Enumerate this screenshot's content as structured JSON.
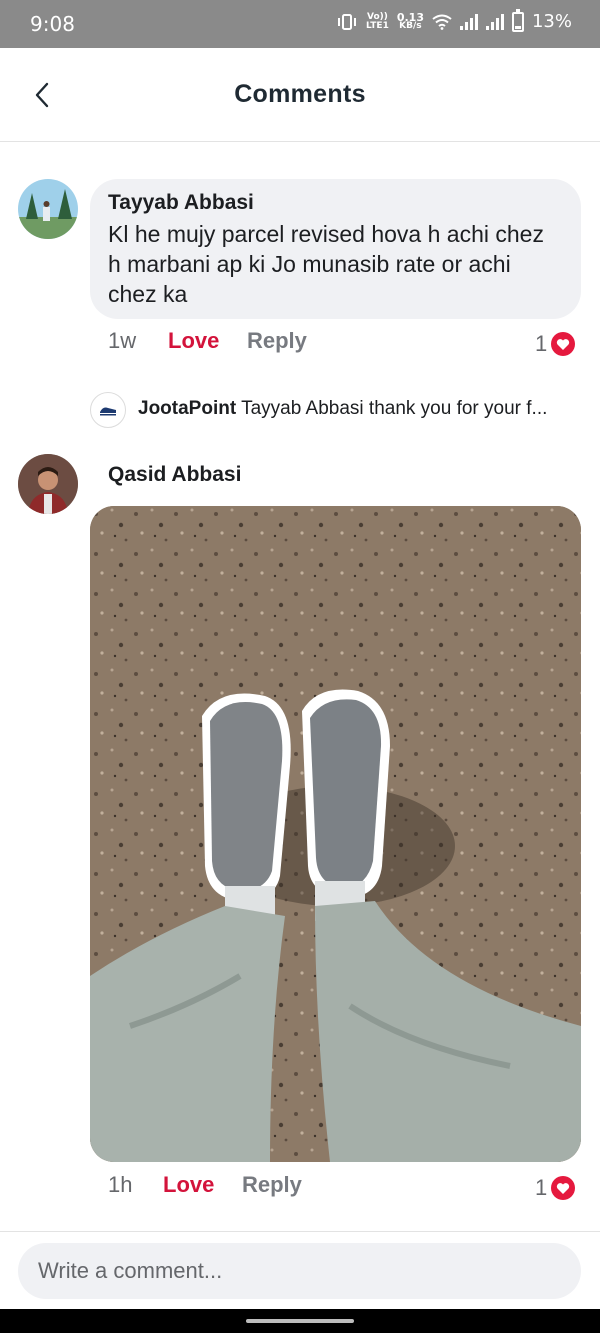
{
  "status_bar": {
    "time": "9:08",
    "lte_label_top": "Vo))",
    "lte_label_bottom": "LTE1",
    "speed_value": "0.13",
    "speed_unit": "KB/s",
    "battery_text": "13%",
    "battery_level_percent": 13
  },
  "header": {
    "title": "Comments"
  },
  "comments": [
    {
      "author": "Tayyab Abbasi",
      "text": "Kl he mujy parcel revised hova h achi chez h marbani ap ki Jo munasib rate or achi chez ka",
      "time": "1w",
      "love_label": "Love",
      "reply_label": "Reply",
      "likes": "1",
      "reply": {
        "author": "JootaPoint",
        "text": "Tayyab Abbasi thank you for your f..."
      }
    },
    {
      "author": "Qasid Abbasi",
      "time": "1h",
      "love_label": "Love",
      "reply_label": "Reply",
      "likes": "1"
    }
  ],
  "composer": {
    "placeholder": "Write a comment..."
  },
  "colors": {
    "love": "#d3133b",
    "heart": "#e5193e",
    "bubble": "#f0f1f4",
    "status_bar": "#8a8a8a"
  }
}
